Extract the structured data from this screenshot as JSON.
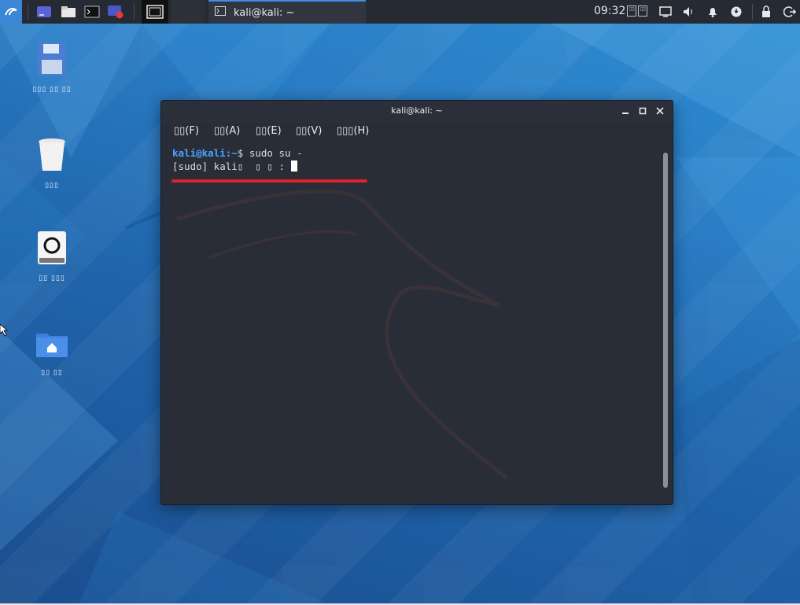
{
  "panel": {
    "task_title": "kali@kali: ~",
    "clock": "09:32"
  },
  "desktop": {
    "icons": [
      {
        "name": "file-system",
        "label": "▯▯▯ ▯▯ ▯▯"
      },
      {
        "name": "trash",
        "label": "▯▯▯"
      },
      {
        "name": "drive",
        "label": "▯▯ ▯▯▯"
      },
      {
        "name": "home",
        "label": "▯▯ ▯▯"
      }
    ]
  },
  "terminal": {
    "title": "kali@kali: ~",
    "menus": [
      "▯▯(F)",
      "▯▯(A)",
      "▯▯(E)",
      "▯▯(V)",
      "▯▯▯(H)"
    ],
    "prompt_user": "kali@kali",
    "prompt_path": ":~",
    "prompt_symbol": "$ ",
    "command": "sudo su -",
    "password_prompt": "[sudo] kali▯  ▯ ▯ : "
  },
  "colors": {
    "highlight_underline": "#e0202a",
    "prompt": "#4da3ff"
  }
}
